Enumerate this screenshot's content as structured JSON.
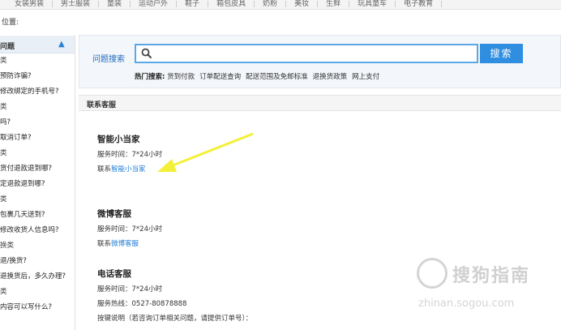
{
  "top_nav": [
    "女装男装",
    "男士服装",
    "童装",
    "运动户外",
    "鞋子",
    "箱包皮具",
    "奶粉",
    "美妆",
    "生鲜",
    "玩具童车",
    "电子教育"
  ],
  "location_label": "位置:",
  "sidebar": {
    "title": "问题",
    "items": [
      {
        "label": "类",
        "category": true
      },
      {
        "label": "预防诈骗?",
        "category": false
      },
      {
        "label": "修改绑定的手机号?",
        "category": false
      },
      {
        "label": "类",
        "category": true
      },
      {
        "label": "吗?",
        "category": false
      },
      {
        "label": "取消订单?",
        "category": false
      },
      {
        "label": "类",
        "category": true
      },
      {
        "label": "货付退款退到哪?",
        "category": false
      },
      {
        "label": "定退款退到哪?",
        "category": false
      },
      {
        "label": "类",
        "category": true
      },
      {
        "label": "包裹几天送到?",
        "category": false
      },
      {
        "label": "修改收货人信息吗?",
        "category": false
      },
      {
        "label": "换类",
        "category": true
      },
      {
        "label": "退/换货?",
        "category": false
      },
      {
        "label": "退换货后，多久办理?",
        "category": false
      },
      {
        "label": "类",
        "category": true
      },
      {
        "label": "内容可以写什么?",
        "category": false
      }
    ]
  },
  "search": {
    "label": "问题搜索",
    "placeholder": "",
    "button": "搜索",
    "hot_label": "热门搜索:",
    "hot_terms": [
      "货到付款",
      "订单配送查询",
      "配送范围及免邮标准",
      "退换货政策",
      "网上支付"
    ]
  },
  "contact_header": "联系客服",
  "sections": {
    "smart": {
      "title": "智能小当家",
      "service_time": "服务时间：7*24小时",
      "contact_prefix": "联系",
      "contact_link": "智能小当家"
    },
    "weibo": {
      "title": "微博客服",
      "service_time": "服务时间：7*24小时",
      "contact_prefix": "联系",
      "contact_link": "微博客服"
    },
    "phone": {
      "title": "电话客服",
      "service_time": "服务时间：7*24小时",
      "hotline": "服务热线：0527-80878888",
      "instructions": "按键说明（若咨询订单相关问题，请提供订单号）："
    }
  },
  "watermark": {
    "text": "搜狗指南",
    "url": "zhinan.sogou.com"
  },
  "colors": {
    "accent": "#2f8ee0",
    "link": "#1e7bd6",
    "arrow": "#f3f03a"
  }
}
